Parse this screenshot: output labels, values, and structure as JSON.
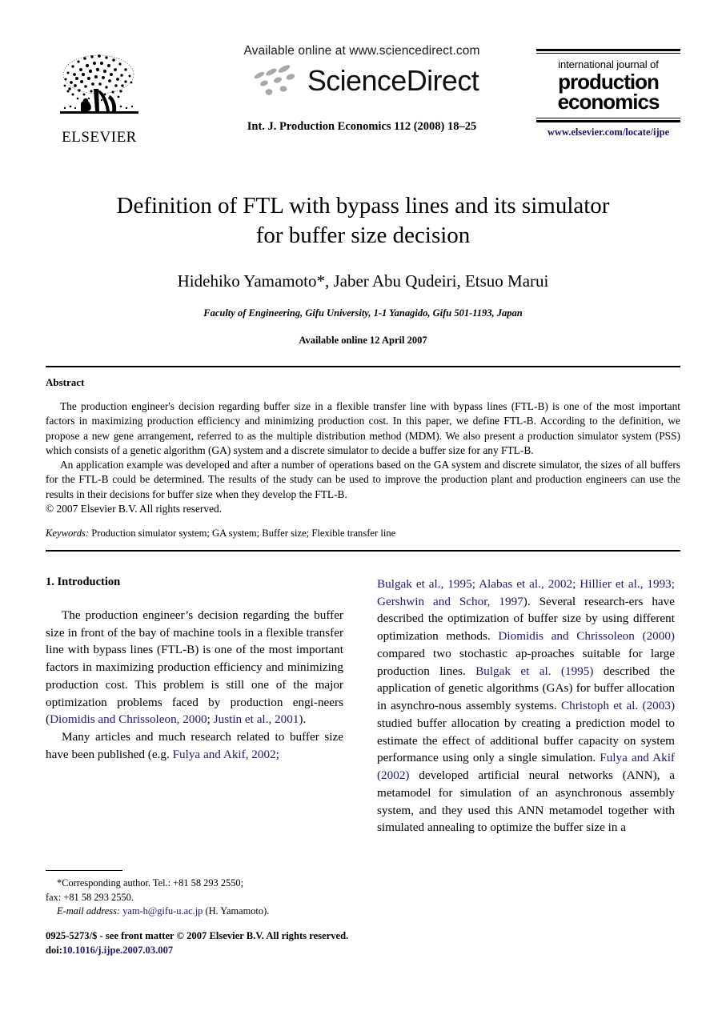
{
  "masthead": {
    "publisher_name": "ELSEVIER",
    "publisher_logo_icon": "elsevier-tree-logo",
    "available_online": "Available online at www.sciencedirect.com",
    "sciencedirect_wordmark": "ScienceDirect",
    "sciencedirect_logo_icon": "sciencedirect-swoosh-icon",
    "journal_reference": "Int. J. Production Economics 112 (2008) 18–25",
    "journal_logo": {
      "line1": "international journal of",
      "line2": "production",
      "line3": "economics",
      "url": "www.elsevier.com/locate/ijpe"
    }
  },
  "article": {
    "title_line1": "Definition of FTL with bypass lines and its simulator",
    "title_line2": "for buffer size decision",
    "authors": "Hidehiko Yamamoto*, Jaber Abu Qudeiri, Etsuo Marui",
    "affiliation": "Faculty of Engineering, Gifu University, 1-1 Yanagido, Gifu 501-1193, Japan",
    "available_online_date": "Available online 12 April 2007"
  },
  "abstract": {
    "heading": "Abstract",
    "paragraph1": "The production engineer's decision regarding buffer size in a flexible transfer line with bypass lines (FTL-B) is one of the most important factors in maximizing production efficiency and minimizing production cost. In this paper, we define FTL-B. According to the definition, we propose a new gene arrangement, referred to as the multiple distribution method (MDM). We also present a production simulator system (PSS) which consists of a genetic algorithm (GA) system and a discrete simulator to decide a buffer size for any FTL-B.",
    "paragraph2": "An application example was developed and after a number of operations based on the GA system and discrete simulator, the sizes of all buffers for the FTL-B could be determined. The results of the study can be used to improve the production plant and production engineers can use the results in their decisions for buffer size when they develop the FTL-B.",
    "copyright": "© 2007 Elsevier B.V. All rights reserved.",
    "keywords_label": "Keywords:",
    "keywords_value": "Production simulator system; GA system; Buffer size; Flexible transfer line"
  },
  "introduction": {
    "heading": "1.  Introduction",
    "left_para1_a": "The production engineer’s decision regarding the buffer size in front of the bay of machine tools in a flexible transfer line with bypass lines (FTL-B) is one of the most important factors in maximizing production efficiency and minimizing production cost. This problem is still one of the major optimization problems faced by production engi-neers (",
    "left_cite1": "Diomidis and Chrissoleon, 2000",
    "left_sep1": "; ",
    "left_cite2": "Justin et al., 2001",
    "left_para1_b": ").",
    "left_para2_a": "Many articles and much research related to buffer size have been published (e.g. ",
    "left_cite3": "Fulya and Akif, 2002",
    "left_para2_b": ";",
    "right_cite1": "Bulgak et al., 1995; Alabas et al., 2002; Hillier et al., 1993; Gershwin and Schor, 1997",
    "right_text1": "). Several research-ers have described the optimization of buffer size by using different optimization methods. ",
    "right_cite2": "Diomidis and Chrissoleon (2000)",
    "right_text2": " compared two stochastic ap-proaches suitable for large production lines. ",
    "right_cite3": "Bulgak et al. (1995)",
    "right_text3": " described the application of genetic algorithms (GAs) for buffer allocation in asynchro-nous assembly systems. ",
    "right_cite4": "Christoph et al. (2003)",
    "right_text4": " studied buffer allocation by creating a prediction model to estimate the effect of additional buffer capacity on system performance using only a single simulation. ",
    "right_cite5": "Fulya and Akif (2002)",
    "right_text5": " developed artificial neural networks (ANN), a metamodel for simulation of an asynchronous assembly system, and they used this ANN metamodel together with simulated annealing to optimize the buffer size in a"
  },
  "footnotes": {
    "corresponding_author": "*Corresponding author. Tel.: +81 58 293 2550;",
    "fax": "fax: +81 58 293 2550.",
    "email_label": "E-mail address:",
    "email_value": "yam-h@gifu-u.ac.jp",
    "email_suffix": " (H. Yamamoto).",
    "front_matter": "0925-5273/$ - see front matter © 2007 Elsevier B.V. All rights reserved.",
    "doi_label": "doi:",
    "doi_value": "10.1016/j.ijpe.2007.03.007"
  },
  "colors": {
    "link": "#1a1a78",
    "journal_url": "#1a1a6e",
    "text": "#000000"
  }
}
